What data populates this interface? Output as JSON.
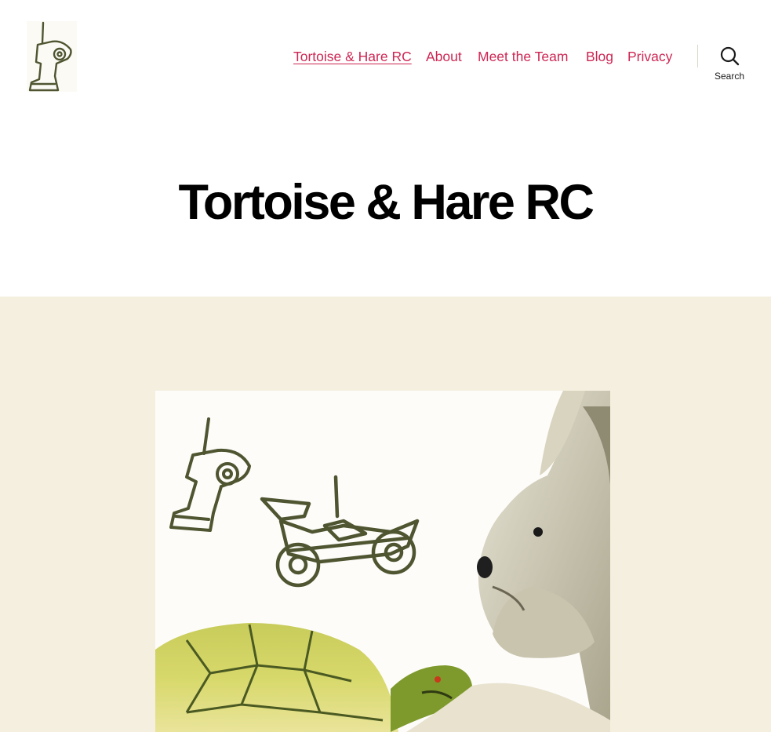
{
  "site": {
    "logo_icon": "rc-transmitter-icon",
    "title": "Tortoise & Hare RC"
  },
  "nav": {
    "items": [
      {
        "label": "Tortoise & Hare RC",
        "current": true
      },
      {
        "label": "About",
        "current": false
      },
      {
        "label": "Meet the Team",
        "current": false
      },
      {
        "label": "Blog",
        "current": false
      },
      {
        "label": "Privacy",
        "current": false
      }
    ],
    "search_label": "Search"
  },
  "featured_image": {
    "icons": [
      "rc-transmitter-icon",
      "rc-buggy-icon",
      "hare-illustration",
      "tortoise-illustration"
    ]
  },
  "colors": {
    "accent": "#cd2653",
    "cover_background": "#f5efe0",
    "icon_olive": "#4f5530"
  }
}
